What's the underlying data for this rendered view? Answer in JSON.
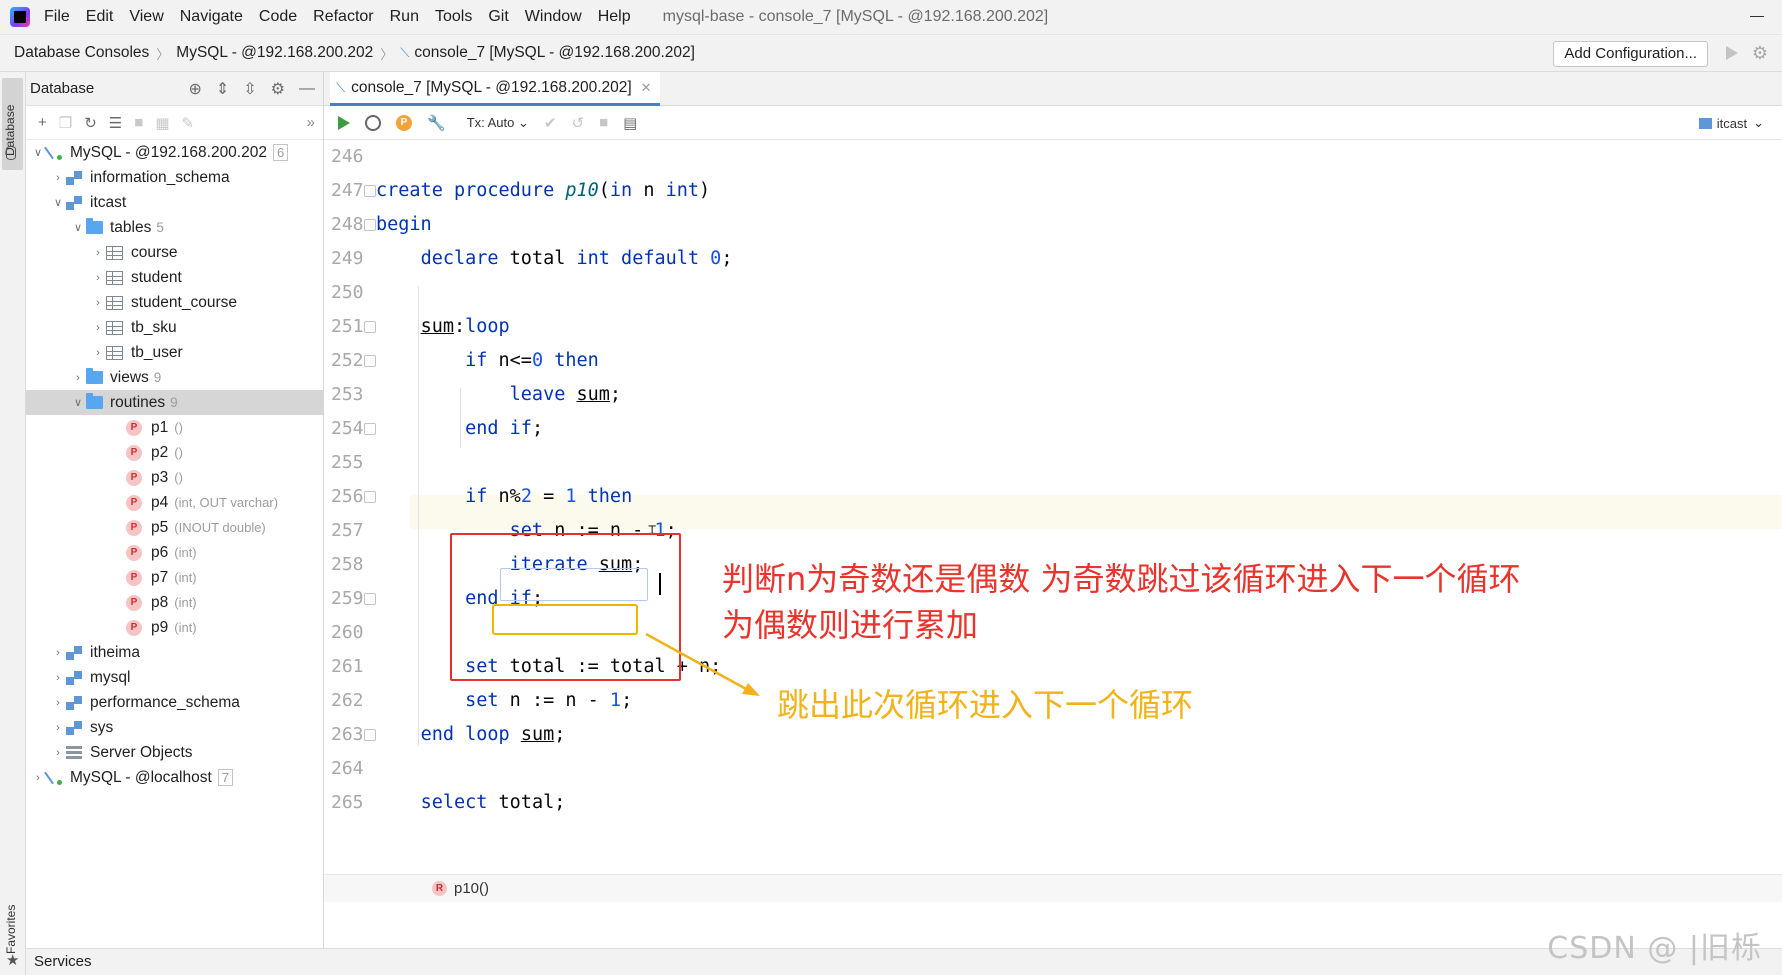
{
  "menubar": {
    "items": [
      {
        "label": "File"
      },
      {
        "label": "Edit"
      },
      {
        "label": "View"
      },
      {
        "label": "Navigate"
      },
      {
        "label": "Code"
      },
      {
        "label": "Refactor"
      },
      {
        "label": "Run"
      },
      {
        "label": "Tools"
      },
      {
        "label": "Git"
      },
      {
        "label": "Window"
      },
      {
        "label": "Help"
      }
    ],
    "window_title": "mysql-base - console_7 [MySQL - @192.168.200.202]"
  },
  "breadcrumb": {
    "items": [
      "Database Consoles",
      "MySQL - @192.168.200.202",
      "console_7 [MySQL - @192.168.200.202]"
    ],
    "add_configuration": "Add Configuration..."
  },
  "left_strip": {
    "database_tab": "Database",
    "favorites_tab": "Favorites"
  },
  "db_panel": {
    "title": "Database",
    "tree": {
      "connection1": {
        "label": "MySQL - @192.168.200.202",
        "count": "6"
      },
      "information_schema": "information_schema",
      "itcast": "itcast",
      "tables": {
        "label": "tables",
        "count": "5"
      },
      "table_items": [
        "course",
        "student",
        "student_course",
        "tb_sku",
        "tb_user"
      ],
      "views": {
        "label": "views",
        "count": "9"
      },
      "routines": {
        "label": "routines",
        "count": "9"
      },
      "routine_items": [
        {
          "name": "p1",
          "sig": "()"
        },
        {
          "name": "p2",
          "sig": "()"
        },
        {
          "name": "p3",
          "sig": "()"
        },
        {
          "name": "p4",
          "sig": "(int, OUT varchar)"
        },
        {
          "name": "p5",
          "sig": "(INOUT double)"
        },
        {
          "name": "p6",
          "sig": "(int)"
        },
        {
          "name": "p7",
          "sig": "(int)"
        },
        {
          "name": "p8",
          "sig": "(int)"
        },
        {
          "name": "p9",
          "sig": "(int)"
        }
      ],
      "schemas": [
        "itheima",
        "mysql",
        "performance_schema",
        "sys"
      ],
      "server_objects": "Server Objects",
      "connection2": {
        "label": "MySQL - @localhost",
        "count": "7"
      }
    }
  },
  "editor": {
    "tab_label": "console_7 [MySQL - @192.168.200.202]",
    "tx_mode": "Tx: Auto",
    "schema": "itcast",
    "line_numbers": [
      "246",
      "247",
      "248",
      "249",
      "250",
      "251",
      "252",
      "253",
      "254",
      "255",
      "256",
      "257",
      "258",
      "259",
      "260",
      "261",
      "262",
      "263",
      "264",
      "265"
    ],
    "code_text": {
      "create": "create procedure ",
      "p10": "p10",
      "open": "(",
      "in": "in",
      "n_sp": " n ",
      "int": "int",
      "close": ")",
      "begin": "begin",
      "declare": "declare",
      "total_sp": " total ",
      "default": " default ",
      "zero": "0",
      "semi": ";",
      "sum": "sum",
      "colon": ":",
      "loop": "loop",
      "if": "if",
      "n_le": " n<=",
      "then": " then",
      "leave": "leave",
      "sp": " ",
      "end": "end",
      "n_mod": " n%",
      "two": "2",
      "eq": " = ",
      "one": "1",
      "set": "set",
      "n_assign": " n := n - ",
      "iterate": "iterate",
      "total_assign": " total := total + n",
      "end_loop": "end loop",
      "select": "select",
      "total_semi": " total;"
    },
    "status_crumb": "p10()"
  },
  "annotations": {
    "red_line1": "判断n为奇数还是偶数  为奇数跳过该循环进入下一个循环",
    "red_line2": "为偶数则进行累加",
    "yellow": "跳出此次循环进入下一个循环"
  },
  "services": "Services",
  "watermark": "CSDN @ |旧栎"
}
